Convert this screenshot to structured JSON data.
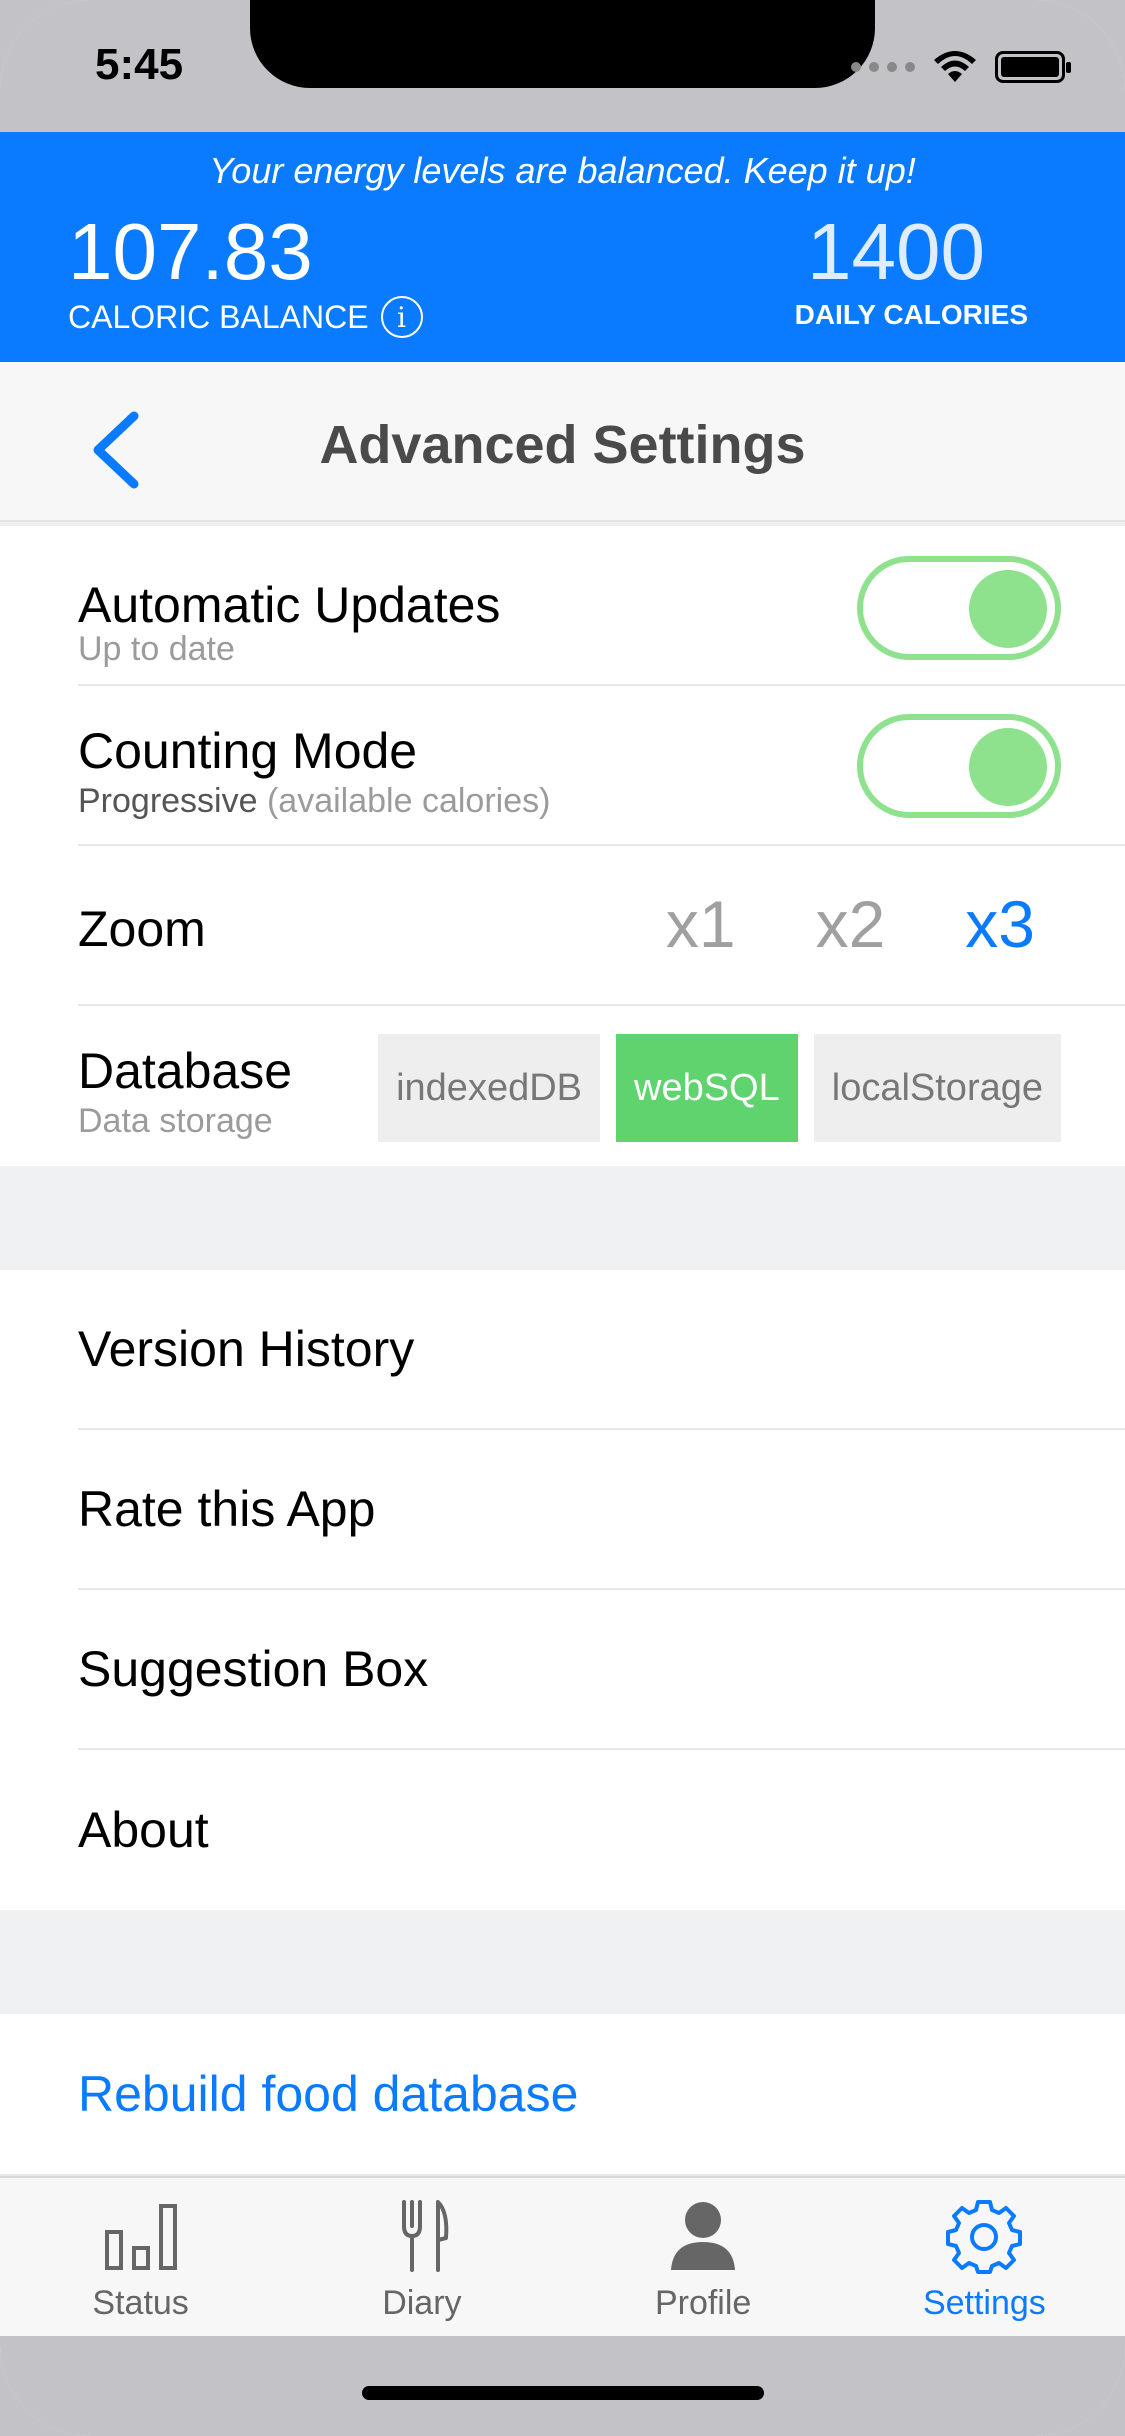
{
  "status_bar": {
    "time": "5:45"
  },
  "banner": {
    "message": "Your energy levels are balanced. Keep it up!",
    "balance_value": "107.83",
    "balance_label": "CALORIC BALANCE",
    "info_glyph": "i",
    "daily_value": "1400",
    "daily_label": "DAILY CALORIES"
  },
  "header": {
    "title": "Advanced Settings"
  },
  "settings": {
    "auto_updates": {
      "title": "Automatic Updates",
      "subtitle": "Up to date",
      "enabled": true
    },
    "counting_mode": {
      "title": "Counting Mode",
      "subtitle_main": "Progressive",
      "subtitle_note": "(available calories)",
      "enabled": true
    },
    "zoom": {
      "title": "Zoom",
      "options": [
        "x1",
        "x2",
        "x3"
      ],
      "selected": "x3"
    },
    "database": {
      "title": "Database",
      "subtitle": "Data storage",
      "options": [
        "indexedDB",
        "webSQL",
        "localStorage"
      ],
      "selected": "webSQL"
    }
  },
  "links": [
    "Version History",
    "Rate this App",
    "Suggestion Box",
    "About"
  ],
  "actions": {
    "rebuild": "Rebuild food database"
  },
  "tabs": [
    {
      "label": "Status",
      "icon": "bar-chart-icon"
    },
    {
      "label": "Diary",
      "icon": "fork-knife-icon"
    },
    {
      "label": "Profile",
      "icon": "person-icon"
    },
    {
      "label": "Settings",
      "icon": "gear-icon",
      "active": true
    }
  ],
  "colors": {
    "accent": "#0a7bff",
    "toggle_on": "#8ee28e",
    "db_selected": "#5fd36e"
  }
}
